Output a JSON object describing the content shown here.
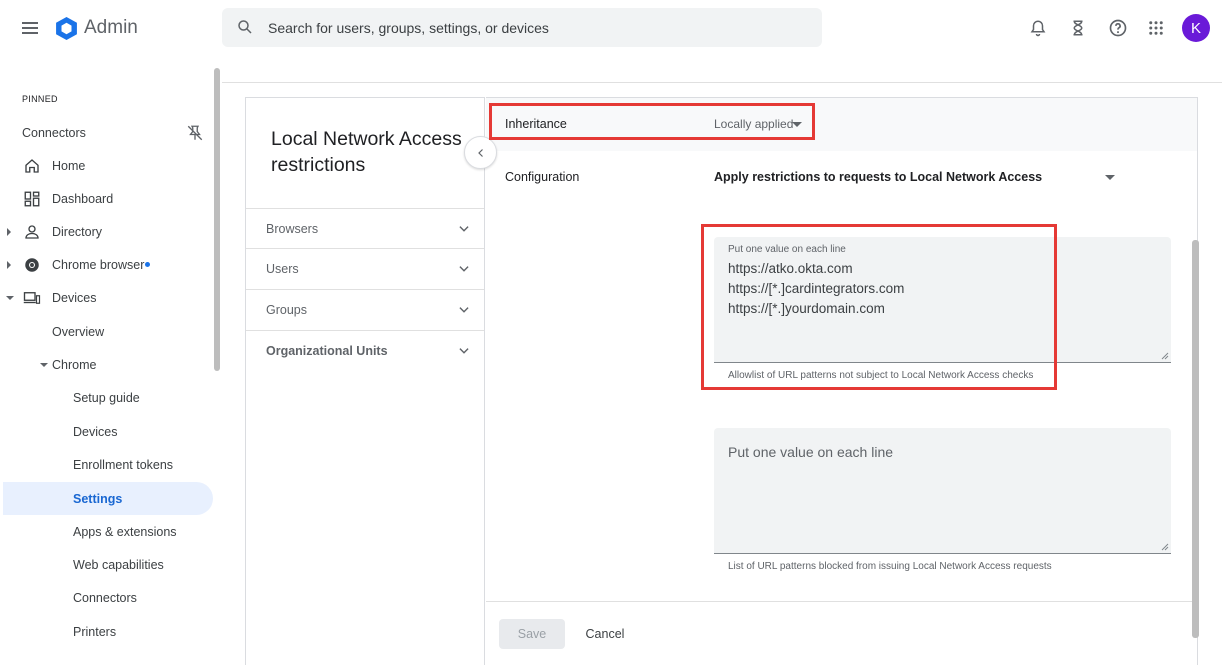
{
  "header": {
    "app_title": "Admin",
    "search_placeholder": "Search for users, groups, settings, or devices",
    "avatar_initial": "K",
    "icons": [
      "menu-icon",
      "admin-logo",
      "search-icon",
      "bell-icon",
      "hourglass-icon",
      "help-icon",
      "apps-grid-icon"
    ]
  },
  "sidebar": {
    "pinned_label": "PINNED",
    "pinned_item": "Connectors",
    "items": [
      {
        "label": "Home",
        "icon": "home-icon"
      },
      {
        "label": "Dashboard",
        "icon": "dashboard-icon"
      },
      {
        "label": "Directory",
        "icon": "person-icon"
      },
      {
        "label": "Chrome browser",
        "icon": "chrome-icon"
      },
      {
        "label": "Devices",
        "icon": "devices-icon"
      },
      {
        "label": "Overview"
      },
      {
        "label": "Chrome"
      },
      {
        "label": "Setup guide"
      },
      {
        "label": "Devices"
      },
      {
        "label": "Enrollment tokens"
      },
      {
        "label": "Settings"
      },
      {
        "label": "Apps & extensions"
      },
      {
        "label": "Web capabilities"
      },
      {
        "label": "Connectors"
      },
      {
        "label": "Printers"
      }
    ]
  },
  "policy_panel": {
    "title": "Local Network Access restrictions",
    "filters": [
      {
        "label": "Browsers"
      },
      {
        "label": "Users"
      },
      {
        "label": "Groups"
      },
      {
        "label": "Organizational Units"
      }
    ]
  },
  "settings": {
    "inheritance_label": "Inheritance",
    "inheritance_value": "Locally applied",
    "configuration_label": "Configuration",
    "configuration_value": "Apply restrictions to requests to Local Network Access",
    "allowlist": {
      "label": "Put one value on each line",
      "lines": [
        "https://atko.okta.com",
        "https://[*.]cardintegrators.com",
        "https://[*.]yourdomain.com"
      ],
      "helper": "Allowlist of URL patterns not subject to Local Network Access checks"
    },
    "blocklist": {
      "placeholder": "Put one value on each line",
      "helper": "List of URL patterns blocked from issuing Local Network Access requests"
    },
    "save_label": "Save",
    "cancel_label": "Cancel"
  },
  "colors": {
    "accent": "#1a73e8",
    "highlight": "#e53935",
    "avatar": "#6a1ad8"
  }
}
